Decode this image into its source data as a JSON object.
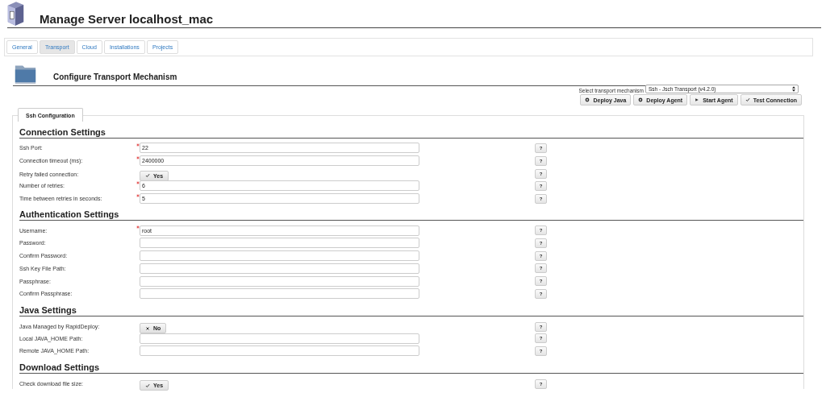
{
  "window": {
    "title": "Manage Server localhost_mac"
  },
  "tabs": [
    {
      "label": "General",
      "selected": false
    },
    {
      "label": "Transport",
      "selected": true
    },
    {
      "label": "Cloud",
      "selected": false
    },
    {
      "label": "Installations",
      "selected": false
    },
    {
      "label": "Projects",
      "selected": false
    }
  ],
  "transport": {
    "title": "Configure Transport Mechanism",
    "select_label": "Select transport mechanism",
    "select_value": "Ssh - Jsch Transport (v4.2.0)"
  },
  "actions": [
    {
      "label": "Deploy Java",
      "kind": "gear"
    },
    {
      "label": "Deploy Agent",
      "kind": "gear"
    },
    {
      "label": "Start Agent",
      "kind": "play"
    },
    {
      "label": "Test Connection",
      "kind": "check"
    }
  ],
  "inner_tab": {
    "label": "Ssh Configuration",
    "selected": true
  },
  "sections": [
    {
      "title": "Connection Settings",
      "rows": [
        {
          "kind": "text",
          "label": "Ssh Port:",
          "required": true,
          "value": "22",
          "help": "?"
        },
        {
          "kind": "text",
          "label": "Connection timeout (ms):",
          "required": true,
          "value": "2400000",
          "help": "?"
        },
        {
          "kind": "toggle",
          "label": "Retry failed connection:",
          "on": true,
          "value": "Yes",
          "help": "?"
        },
        {
          "kind": "text",
          "label": "Number of retries:",
          "required": true,
          "value": "6",
          "help": "?"
        },
        {
          "kind": "text",
          "label": "Time between retries in seconds:",
          "required": true,
          "value": "5",
          "help": "?"
        }
      ]
    },
    {
      "title": "Authentication Settings",
      "rows": [
        {
          "kind": "text",
          "label": "Username:",
          "required": true,
          "value": "root",
          "help": "?"
        },
        {
          "kind": "text",
          "label": "Password:",
          "required": false,
          "help": "?"
        },
        {
          "kind": "text",
          "label": "Confirm Password:",
          "required": false,
          "help": "?"
        },
        {
          "kind": "text",
          "label": "Ssh Key File Path:",
          "required": false,
          "help": "?"
        },
        {
          "kind": "text",
          "label": "Passphrase:",
          "required": false,
          "help": "?"
        },
        {
          "kind": "text",
          "label": "Confirm Passphrase:",
          "required": false,
          "help": "?"
        }
      ]
    },
    {
      "title": "Java Settings",
      "rows": [
        {
          "kind": "toggle",
          "label": "Java Managed by RapidDeploy:",
          "on": false,
          "value": "No",
          "help": "?"
        },
        {
          "kind": "text",
          "label": "Local JAVA_HOME Path:",
          "required": false,
          "help": "?"
        },
        {
          "kind": "text",
          "label": "Remote JAVA_HOME Path:",
          "required": false,
          "help": "?"
        }
      ]
    },
    {
      "title": "Download Settings",
      "rows": [
        {
          "kind": "toggle",
          "label": "Check download file size:",
          "on": true,
          "value": "Yes",
          "help": "?"
        }
      ]
    }
  ]
}
